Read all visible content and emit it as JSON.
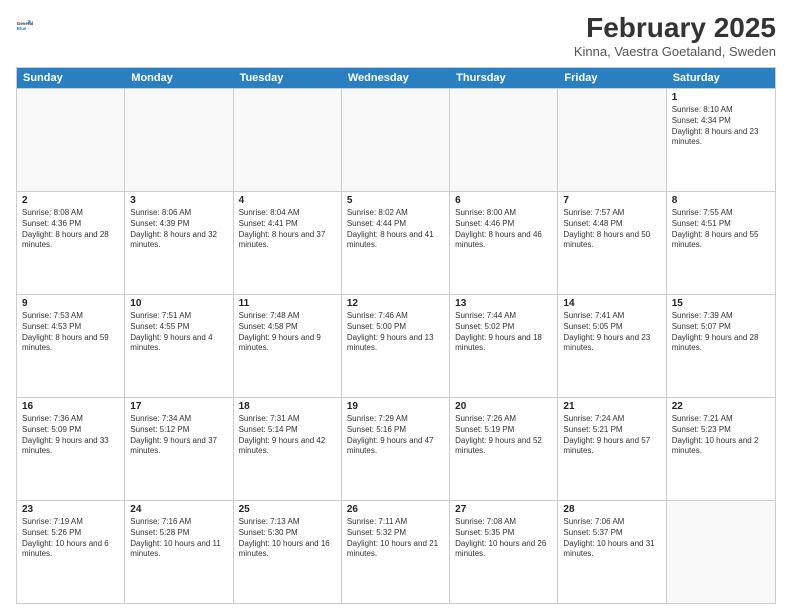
{
  "header": {
    "logo_line1": "General",
    "logo_line2": "Blue",
    "month": "February 2025",
    "location": "Kinna, Vaestra Goetaland, Sweden"
  },
  "days_of_week": [
    "Sunday",
    "Monday",
    "Tuesday",
    "Wednesday",
    "Thursday",
    "Friday",
    "Saturday"
  ],
  "weeks": [
    [
      {
        "day": "",
        "info": ""
      },
      {
        "day": "",
        "info": ""
      },
      {
        "day": "",
        "info": ""
      },
      {
        "day": "",
        "info": ""
      },
      {
        "day": "",
        "info": ""
      },
      {
        "day": "",
        "info": ""
      },
      {
        "day": "1",
        "info": "Sunrise: 8:10 AM\nSunset: 4:34 PM\nDaylight: 8 hours and 23 minutes."
      }
    ],
    [
      {
        "day": "2",
        "info": "Sunrise: 8:08 AM\nSunset: 4:36 PM\nDaylight: 8 hours and 28 minutes."
      },
      {
        "day": "3",
        "info": "Sunrise: 8:06 AM\nSunset: 4:39 PM\nDaylight: 8 hours and 32 minutes."
      },
      {
        "day": "4",
        "info": "Sunrise: 8:04 AM\nSunset: 4:41 PM\nDaylight: 8 hours and 37 minutes."
      },
      {
        "day": "5",
        "info": "Sunrise: 8:02 AM\nSunset: 4:44 PM\nDaylight: 8 hours and 41 minutes."
      },
      {
        "day": "6",
        "info": "Sunrise: 8:00 AM\nSunset: 4:46 PM\nDaylight: 8 hours and 46 minutes."
      },
      {
        "day": "7",
        "info": "Sunrise: 7:57 AM\nSunset: 4:48 PM\nDaylight: 8 hours and 50 minutes."
      },
      {
        "day": "8",
        "info": "Sunrise: 7:55 AM\nSunset: 4:51 PM\nDaylight: 8 hours and 55 minutes."
      }
    ],
    [
      {
        "day": "9",
        "info": "Sunrise: 7:53 AM\nSunset: 4:53 PM\nDaylight: 8 hours and 59 minutes."
      },
      {
        "day": "10",
        "info": "Sunrise: 7:51 AM\nSunset: 4:55 PM\nDaylight: 9 hours and 4 minutes."
      },
      {
        "day": "11",
        "info": "Sunrise: 7:48 AM\nSunset: 4:58 PM\nDaylight: 9 hours and 9 minutes."
      },
      {
        "day": "12",
        "info": "Sunrise: 7:46 AM\nSunset: 5:00 PM\nDaylight: 9 hours and 13 minutes."
      },
      {
        "day": "13",
        "info": "Sunrise: 7:44 AM\nSunset: 5:02 PM\nDaylight: 9 hours and 18 minutes."
      },
      {
        "day": "14",
        "info": "Sunrise: 7:41 AM\nSunset: 5:05 PM\nDaylight: 9 hours and 23 minutes."
      },
      {
        "day": "15",
        "info": "Sunrise: 7:39 AM\nSunset: 5:07 PM\nDaylight: 9 hours and 28 minutes."
      }
    ],
    [
      {
        "day": "16",
        "info": "Sunrise: 7:36 AM\nSunset: 5:09 PM\nDaylight: 9 hours and 33 minutes."
      },
      {
        "day": "17",
        "info": "Sunrise: 7:34 AM\nSunset: 5:12 PM\nDaylight: 9 hours and 37 minutes."
      },
      {
        "day": "18",
        "info": "Sunrise: 7:31 AM\nSunset: 5:14 PM\nDaylight: 9 hours and 42 minutes."
      },
      {
        "day": "19",
        "info": "Sunrise: 7:29 AM\nSunset: 5:16 PM\nDaylight: 9 hours and 47 minutes."
      },
      {
        "day": "20",
        "info": "Sunrise: 7:26 AM\nSunset: 5:19 PM\nDaylight: 9 hours and 52 minutes."
      },
      {
        "day": "21",
        "info": "Sunrise: 7:24 AM\nSunset: 5:21 PM\nDaylight: 9 hours and 57 minutes."
      },
      {
        "day": "22",
        "info": "Sunrise: 7:21 AM\nSunset: 5:23 PM\nDaylight: 10 hours and 2 minutes."
      }
    ],
    [
      {
        "day": "23",
        "info": "Sunrise: 7:19 AM\nSunset: 5:26 PM\nDaylight: 10 hours and 6 minutes."
      },
      {
        "day": "24",
        "info": "Sunrise: 7:16 AM\nSunset: 5:28 PM\nDaylight: 10 hours and 11 minutes."
      },
      {
        "day": "25",
        "info": "Sunrise: 7:13 AM\nSunset: 5:30 PM\nDaylight: 10 hours and 16 minutes."
      },
      {
        "day": "26",
        "info": "Sunrise: 7:11 AM\nSunset: 5:32 PM\nDaylight: 10 hours and 21 minutes."
      },
      {
        "day": "27",
        "info": "Sunrise: 7:08 AM\nSunset: 5:35 PM\nDaylight: 10 hours and 26 minutes."
      },
      {
        "day": "28",
        "info": "Sunrise: 7:06 AM\nSunset: 5:37 PM\nDaylight: 10 hours and 31 minutes."
      },
      {
        "day": "",
        "info": ""
      }
    ]
  ]
}
